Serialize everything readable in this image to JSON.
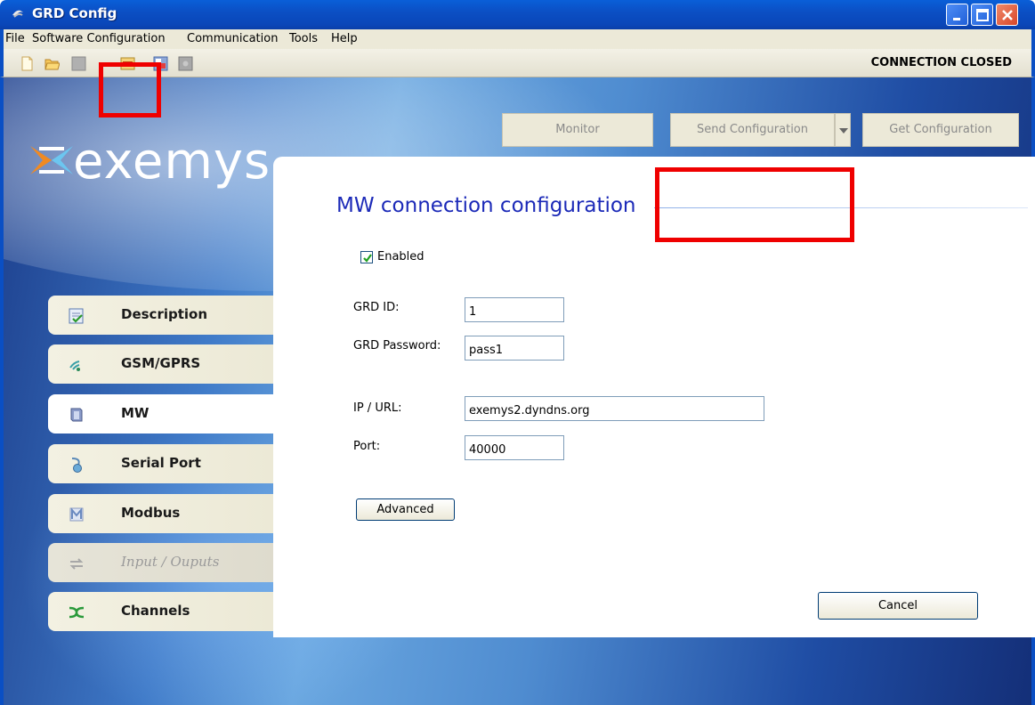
{
  "window": {
    "title": "GRD Config"
  },
  "menu": [
    "File",
    "Software Configuration",
    "Communication",
    "Tools",
    "Help"
  ],
  "toolbar": {
    "icons": [
      "new-file-icon",
      "open-folder-icon",
      "save-icon",
      "connect-icon",
      "disconnect-icon",
      "settings-icon"
    ],
    "status": "CONNECTION CLOSED"
  },
  "brand": {
    "logo_text": "exemys"
  },
  "actions": {
    "monitor": "Monitor",
    "send": "Send Configuration",
    "get": "Get Configuration"
  },
  "sidebar": {
    "items": [
      {
        "label": "Description",
        "icon": "description-icon",
        "state": "normal"
      },
      {
        "label": "GSM/GPRS",
        "icon": "wireless-icon",
        "state": "normal"
      },
      {
        "label": "MW",
        "icon": "server-icon",
        "state": "active"
      },
      {
        "label": "Serial Port",
        "icon": "serial-port-icon",
        "state": "normal"
      },
      {
        "label": "Modbus",
        "icon": "modbus-icon",
        "state": "normal"
      },
      {
        "label": "Input / Ouputs",
        "icon": "io-arrows-icon",
        "state": "disabled"
      },
      {
        "label": "Channels",
        "icon": "channels-icon",
        "state": "normal"
      }
    ]
  },
  "form": {
    "title": "MW connection configuration",
    "enabled_label": "Enabled",
    "enabled": true,
    "grd_id_label": "GRD ID:",
    "grd_id": "1",
    "grd_password_label": "GRD Password:",
    "grd_password": "pass1",
    "ip_url_label": "IP / URL:",
    "ip_url": "exemys2.dyndns.org",
    "port_label": "Port:",
    "port": "40000",
    "advanced": "Advanced",
    "cancel": "Cancel"
  },
  "colors": {
    "highlight": "#ef0000",
    "title_text": "#1c2ab8",
    "xp_blue": "#0a4fc4"
  }
}
